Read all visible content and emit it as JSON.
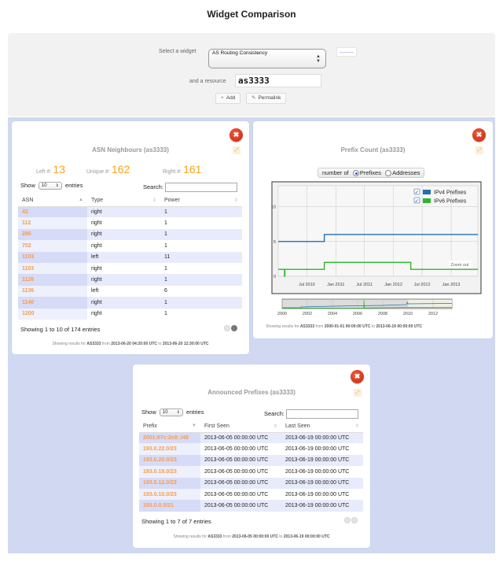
{
  "page": {
    "title": "Widget Comparison"
  },
  "controls": {
    "select_label": "Select a widget",
    "selected_widget": "AS Routing Consistency",
    "resource_label": "and a resource",
    "resource_value": "as3333",
    "add_label": "Add",
    "add_icon": "plus-icon",
    "permalink_label": "Permalink",
    "permalink_icon": "pencil-icon"
  },
  "asn_widget": {
    "title": "ASN Neighbours (as3333)",
    "stats": {
      "left_label": "Left #:",
      "left_value": "13",
      "unique_label": "Unique #:",
      "unique_value": "162",
      "right_label": "Right #:",
      "right_value": "161"
    },
    "show_label": "Show",
    "page_length": "10",
    "entries_label": "entries",
    "search_label": "Search:",
    "columns": [
      "ASN",
      "Type",
      "Power"
    ],
    "rows": [
      [
        "42",
        "right",
        "1"
      ],
      [
        "112",
        "right",
        "1"
      ],
      [
        "286",
        "right",
        "1"
      ],
      [
        "702",
        "right",
        "1"
      ],
      [
        "1103",
        "left",
        "11"
      ],
      [
        "1103",
        "right",
        "1"
      ],
      [
        "1126",
        "right",
        "1"
      ],
      [
        "1136",
        "left",
        "6"
      ],
      [
        "1140",
        "right",
        "1"
      ],
      [
        "1200",
        "right",
        "1"
      ]
    ],
    "info": "Showing 1 to 10 of 174 entries",
    "footnote": {
      "prefix": "Showing results for",
      "resource": "AS3333",
      "from_label": "from",
      "from": "2013-06-20 04:20:00 UTC",
      "to_label": "to",
      "to": "2013-06-20 12:30:00 UTC"
    }
  },
  "prefix_count_widget": {
    "title": "Prefix Count (as3333)",
    "toggle_label": "number of",
    "options": [
      "Prefixes",
      "Addresses"
    ],
    "selected_option": "Prefixes",
    "zoom_out_label": "Zoom out",
    "footnote": {
      "prefix": "Showing results for",
      "resource": "AS3333",
      "from_label": "from",
      "from": "2000-01-01 00:00:00 UTC",
      "to_label": "to",
      "to": "2013-06-19 00:00:00 UTC"
    }
  },
  "announced_widget": {
    "title": "Announced Prefixes (as3333)",
    "show_label": "Show",
    "page_length": "10",
    "entries_label": "entries",
    "search_label": "Search:",
    "columns": [
      "Prefix",
      "First Seen",
      "Last Seen"
    ],
    "rows": [
      [
        "2001:67c:2e8::/48",
        "2013-06-05 00:00:00 UTC",
        "2013-06-19 00:00:00 UTC"
      ],
      [
        "193.0.22.0/23",
        "2013-06-05 00:00:00 UTC",
        "2013-06-19 00:00:00 UTC"
      ],
      [
        "193.0.20.0/23",
        "2013-06-05 00:00:00 UTC",
        "2013-06-19 00:00:00 UTC"
      ],
      [
        "193.0.18.0/23",
        "2013-06-05 00:00:00 UTC",
        "2013-06-19 00:00:00 UTC"
      ],
      [
        "193.0.12.0/23",
        "2013-06-05 00:00:00 UTC",
        "2013-06-19 00:00:00 UTC"
      ],
      [
        "193.0.10.0/23",
        "2013-06-05 00:00:00 UTC",
        "2013-06-19 00:00:00 UTC"
      ],
      [
        "193.0.0.0/21",
        "2013-06-05 00:00:00 UTC",
        "2013-06-19 00:00:00 UTC"
      ]
    ],
    "info": "Showing 1 to 7 of 7 entries",
    "footnote": {
      "prefix": "Showing results for",
      "resource": "AS3333",
      "from_label": "from",
      "from": "2013-06-05 00:00:00 UTC",
      "to_label": "to",
      "to": "2013-06-19 00:00:00 UTC"
    }
  },
  "colors": {
    "accent": "#f7a51c",
    "link": "#f79d4a",
    "ipv4": "#1f6fb2",
    "ipv6": "#2db52d",
    "close": "#d9361a",
    "widget_bg": "#d0d9f1"
  },
  "chart_data": {
    "type": "line",
    "title": "Prefix Count (as3333)",
    "xlabel": "",
    "ylabel": "",
    "x_range": [
      "2010-01-01",
      "2013-06-19"
    ],
    "ylim": [
      0,
      13
    ],
    "y_ticks": [
      0,
      5,
      10
    ],
    "x_ticks": [
      "Jul 2010",
      "Jan 2011",
      "Jul 2011",
      "Jan 2012",
      "Jul 2012",
      "Jan 2013"
    ],
    "grid": true,
    "legend": "top-right",
    "step": true,
    "series": [
      {
        "name": "IPv4 Prefixes",
        "color": "#1f6fb2",
        "checked": true,
        "points": [
          [
            "2010-01-01",
            5
          ],
          [
            "2010-10-20",
            6
          ],
          [
            "2013-06-19",
            6
          ]
        ]
      },
      {
        "name": "IPv6 Prefixes",
        "color": "#2db52d",
        "checked": true,
        "points": [
          [
            "2010-01-01",
            1
          ],
          [
            "2010-02-10",
            0
          ],
          [
            "2010-02-12",
            1
          ],
          [
            "2010-10-20",
            2
          ],
          [
            "2012-04-20",
            1
          ],
          [
            "2013-06-19",
            1
          ]
        ]
      }
    ],
    "navigator": {
      "x_range": [
        2000,
        2013.5
      ],
      "x_ticks": [
        "2000",
        "2002",
        "2004",
        "2006",
        "2008",
        "2010",
        "2012"
      ],
      "selected_range": [
        2010,
        2013.5
      ]
    }
  }
}
